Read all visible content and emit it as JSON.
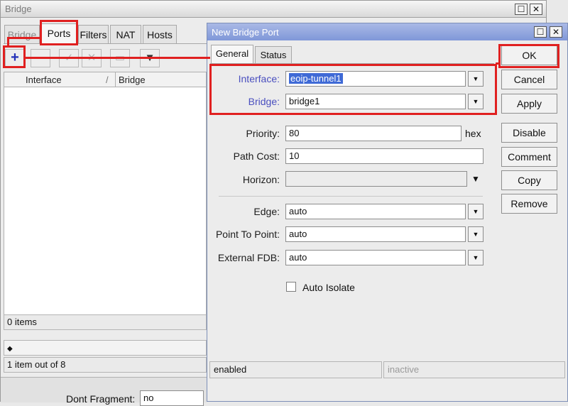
{
  "bridge_window": {
    "title": "Bridge",
    "close": "✕",
    "maximize": "☐",
    "tabs": [
      "Bridge",
      "Ports",
      "Filters",
      "NAT",
      "Hosts"
    ],
    "columns": [
      "Interface",
      "Bridge"
    ],
    "items_count": "0 items",
    "scroll_arrow": "◆",
    "bottom_status": "1 item out of 8",
    "dont_fragment_label": "Dont Fragment:",
    "dont_fragment_value": "no"
  },
  "dialog": {
    "title": "New Bridge Port",
    "tabs": [
      "General",
      "Status"
    ],
    "fields": {
      "interface": {
        "label": "Interface:",
        "value": "eoip-tunnel1"
      },
      "bridge": {
        "label": "Bridge:",
        "value": "bridge1"
      },
      "priority": {
        "label": "Priority:",
        "value": "80",
        "unit": "hex"
      },
      "path_cost": {
        "label": "Path Cost:",
        "value": "10"
      },
      "horizon": {
        "label": "Horizon:",
        "value": ""
      },
      "edge": {
        "label": "Edge:",
        "value": "auto"
      },
      "point_to_point": {
        "label": "Point To Point:",
        "value": "auto"
      },
      "external_fdb": {
        "label": "External FDB:",
        "value": "auto"
      }
    },
    "auto_isolate": "Auto Isolate",
    "buttons": [
      "OK",
      "Cancel",
      "Apply",
      "Disable",
      "Comment",
      "Copy",
      "Remove"
    ],
    "status_left": "enabled",
    "status_right": "inactive"
  },
  "colors": {
    "highlight": "#e02020",
    "title_blue": "#7f97d8",
    "add_icon": "#2330b8"
  }
}
